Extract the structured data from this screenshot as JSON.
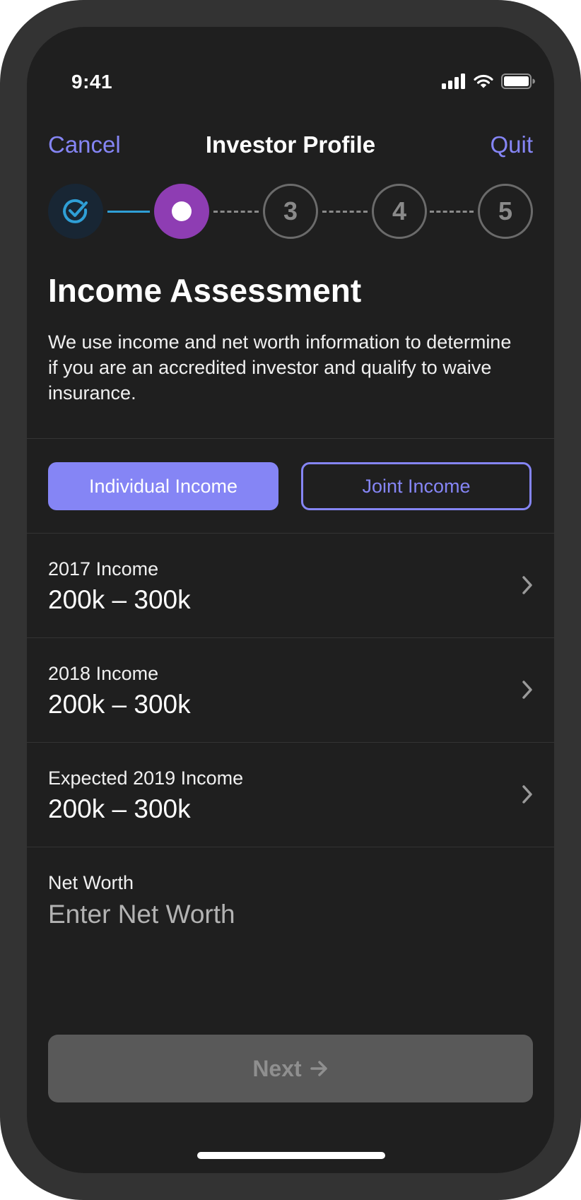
{
  "status_bar": {
    "time": "9:41",
    "icons": [
      "cellular-signal-icon",
      "wifi-icon",
      "battery-icon"
    ]
  },
  "nav": {
    "cancel_label": "Cancel",
    "title": "Investor Profile",
    "quit_label": "Quit"
  },
  "stepper": {
    "steps": [
      {
        "state": "completed",
        "icon": "check-circle-icon"
      },
      {
        "state": "current"
      },
      {
        "state": "pending",
        "label": "3"
      },
      {
        "state": "pending",
        "label": "4"
      },
      {
        "state": "pending",
        "label": "5"
      }
    ]
  },
  "main": {
    "heading": "Income Assessment",
    "description": "We use income and net worth information to determine if you are an accredited investor and qualify to waive insurance."
  },
  "income_type": {
    "options": [
      {
        "label": "Individual Income",
        "selected": true
      },
      {
        "label": "Joint Income",
        "selected": false
      }
    ]
  },
  "income_rows": [
    {
      "label": "2017 Income",
      "value": "200k – 300k"
    },
    {
      "label": "2018 Income",
      "value": "200k – 300k"
    },
    {
      "label": "Expected 2019 Income",
      "value": "200k – 300k"
    }
  ],
  "net_worth": {
    "label": "Net Worth",
    "value": "",
    "placeholder": "Enter Net Worth"
  },
  "footer": {
    "next_label": "Next",
    "next_icon": "arrow-right-icon"
  },
  "colors": {
    "accent": "#8585f5",
    "step_current": "#8e3db3",
    "step_done": "#2f9fd6",
    "background": "#1f1f1f",
    "disabled_button": "#595959"
  }
}
